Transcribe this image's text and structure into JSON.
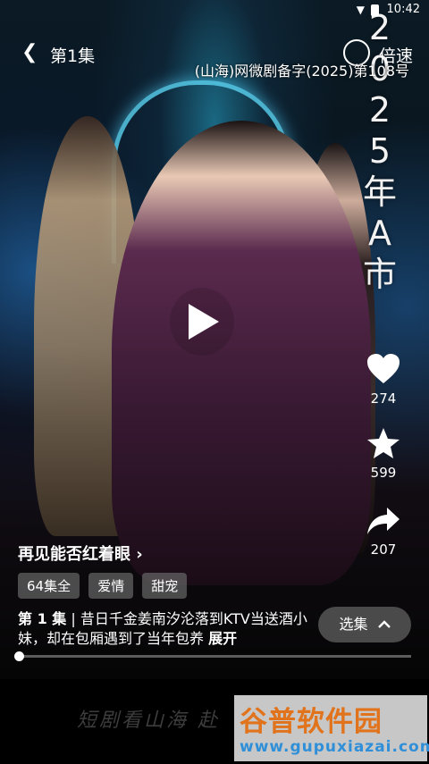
{
  "status_bar": {
    "time": "10:42"
  },
  "top_bar": {
    "episode": "第1集",
    "speed_label": "倍速"
  },
  "overlay": {
    "license": "(山海)网微剧备字(2025)第108号",
    "vertical_text": [
      "2",
      "0",
      "2",
      "5",
      "年",
      "A",
      "市"
    ]
  },
  "side_actions": [
    {
      "icon": "heart-icon",
      "count": "274"
    },
    {
      "icon": "star-icon",
      "count": "599"
    },
    {
      "icon": "share-icon",
      "count": "207"
    }
  ],
  "show": {
    "title": "再见能否红着眼",
    "title_arrow": "›",
    "tags": [
      "64集全",
      "爱情",
      "甜宠"
    ],
    "episode_label": "第 1 集",
    "separator": " | ",
    "description": "昔日千金姜南汐沦落到KTV当送酒小妹，却在包厢遇到了当年包养",
    "expand_label": "展开",
    "select_label": "选集"
  },
  "playback": {
    "progress": 0.0
  },
  "bottom": {
    "slogan": "短剧看山海 赴",
    "watermark_title": "谷普软件园",
    "watermark_url": "www.gupuxiazai.com"
  }
}
